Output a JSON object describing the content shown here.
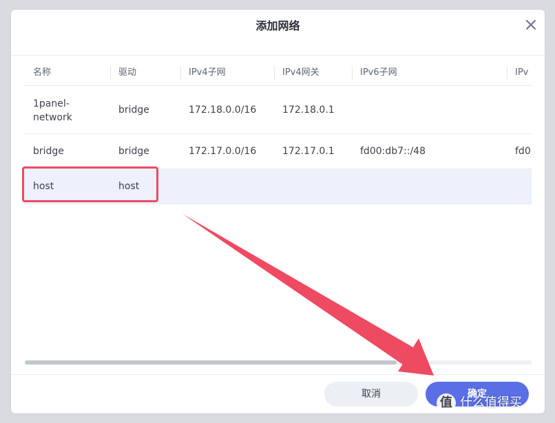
{
  "dialog": {
    "title": "添加网络",
    "cancel_label": "取消",
    "ok_label": "确定"
  },
  "table": {
    "columns": [
      "名称",
      "驱动",
      "IPv4子网",
      "IPv4网关",
      "IPv6子网",
      "IPv"
    ],
    "rows": [
      {
        "name": "1panel-\nnetwork",
        "driver": "bridge",
        "ipv4_subnet": "172.18.0.0/16",
        "ipv4_gateway": "172.18.0.1",
        "ipv6_subnet": "",
        "ipv6_gateway": ""
      },
      {
        "name": "bridge",
        "driver": "bridge",
        "ipv4_subnet": "172.17.0.0/16",
        "ipv4_gateway": "172.17.0.1",
        "ipv6_subnet": "fd00:db7::/48",
        "ipv6_gateway": "fd0"
      },
      {
        "name": "host",
        "driver": "host",
        "ipv4_subnet": "",
        "ipv4_gateway": "",
        "ipv6_subnet": "",
        "ipv6_gateway": ""
      }
    ],
    "selected_row": 2
  },
  "watermark": {
    "badge": "值",
    "text": "什么值得买"
  },
  "colors": {
    "primary": "#5a6ee6",
    "highlight": "#ee4a62",
    "selected_row": "#eef0fb"
  }
}
